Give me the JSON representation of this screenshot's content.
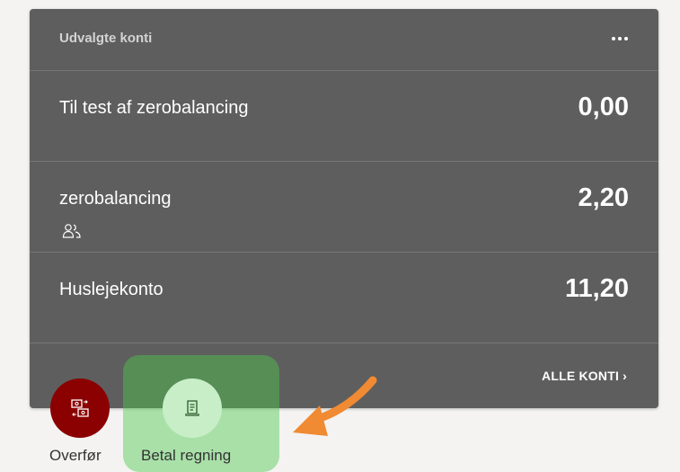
{
  "card": {
    "title": "Udvalgte konti",
    "more_icon": "more-horizontal-icon",
    "all_accounts_label": "ALLE KONTI ›"
  },
  "accounts": [
    {
      "name": "Til test af zerobalancing",
      "balance": "0,00",
      "shared": false
    },
    {
      "name": "zerobalancing",
      "balance": "2,20",
      "shared": true,
      "icon": "shared-users-icon"
    },
    {
      "name": "Huslejekonto",
      "balance": "11,20",
      "shared": false
    }
  ],
  "actions": [
    {
      "label": "Overfør",
      "icon": "transfer-icon",
      "color": "#8b0000"
    },
    {
      "label": "Betal regning",
      "icon": "bill-icon",
      "color": "#c8eec8"
    }
  ],
  "colors": {
    "card_bg": "#5e5e5e",
    "page_bg": "#f4f3f2",
    "highlight": "#4dc94d",
    "arrow": "#f08a33"
  }
}
